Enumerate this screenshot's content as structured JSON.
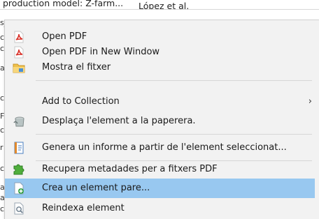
{
  "background": {
    "top_row": {
      "title": "production model: Z-farm...",
      "authors": "López et al."
    },
    "left_fragments": [
      "s_pdf",
      "c",
      "c",
      "a",
      "c",
      "F",
      "c",
      "r",
      "c",
      "a",
      "a",
      "c"
    ]
  },
  "menu": {
    "items": [
      {
        "label": "Open PDF",
        "icon": "pdf-icon"
      },
      {
        "label": "Open PDF in New Window",
        "icon": "pdf-icon"
      },
      {
        "label": "Mostra el fitxer",
        "icon": "folder-icon"
      },
      {
        "label": "Add to Collection",
        "icon": "",
        "submenu": true,
        "chevron": "›"
      },
      {
        "label": "Desplaça l'element a la paperera.",
        "icon": "trash-icon"
      },
      {
        "label": "Genera un informe a partir de l'element seleccionat...",
        "icon": "report-icon"
      },
      {
        "label": "Recupera metadades per a fitxers PDF",
        "icon": "puzzle-icon"
      },
      {
        "label": "Crea un element pare...",
        "icon": "new-parent-icon",
        "highlighted": true
      },
      {
        "label": "Reindexa element",
        "icon": "reindex-icon"
      }
    ]
  },
  "colors": {
    "menu_background": "#f2f2f2",
    "highlight": "#98c8f0",
    "pdf_red": "#d9322a"
  }
}
